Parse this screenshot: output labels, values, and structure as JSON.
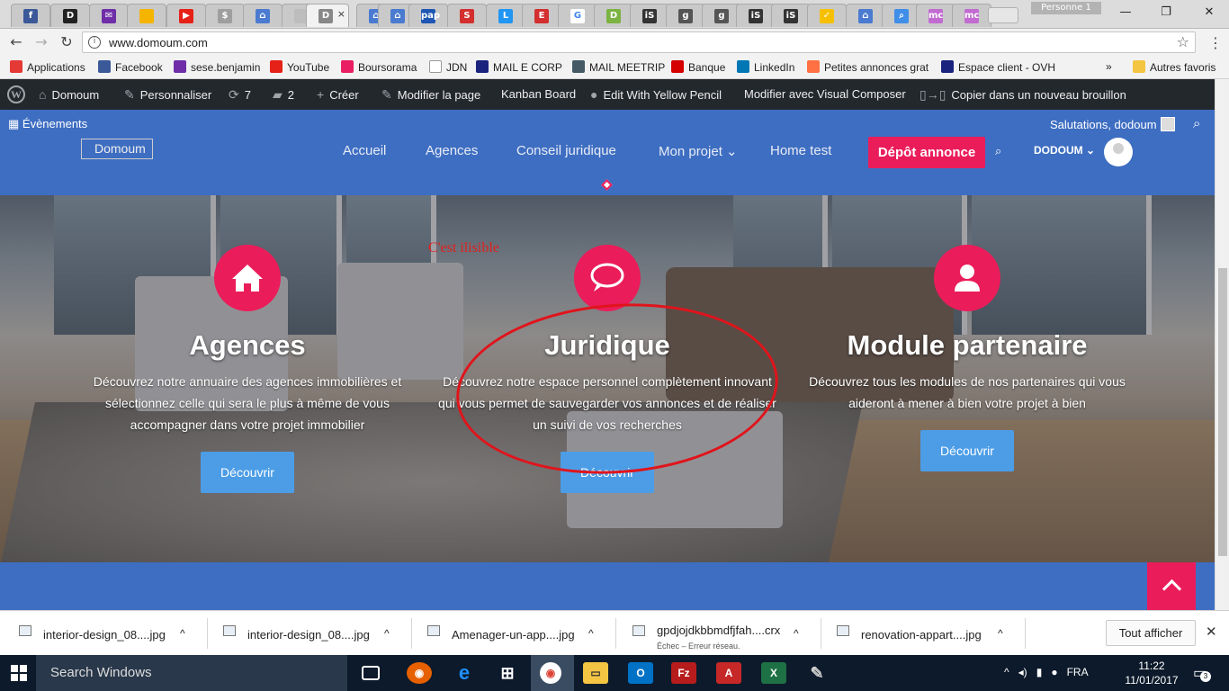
{
  "browser": {
    "tabs": [
      {
        "icon": "facebook-favicon",
        "color": "#3b5998",
        "glyph": "f"
      },
      {
        "icon": "dark-d-favicon",
        "color": "#222",
        "glyph": "D"
      },
      {
        "icon": "mail-favicon",
        "color": "#6f2da8",
        "glyph": "✉"
      },
      {
        "icon": "yellow-favicon",
        "color": "#f4b400",
        "glyph": ""
      },
      {
        "icon": "youtube-favicon",
        "color": "#e62117",
        "glyph": "▶"
      },
      {
        "icon": "page-favicon",
        "color": "#9e9e9e",
        "glyph": "$"
      },
      {
        "icon": "house-favicon",
        "color": "#4a7bd0",
        "glyph": "⌂"
      },
      {
        "icon": "blank-page-favicon",
        "color": "#bdbdbd",
        "glyph": ""
      },
      {
        "icon": "active-tab-favicon",
        "color": "#888",
        "glyph": "D"
      },
      {
        "icon": "house-favicon-2",
        "color": "#4a7bd0",
        "glyph": "⌂"
      },
      {
        "icon": "house-favicon-3",
        "color": "#4a7bd0",
        "glyph": "⌂"
      },
      {
        "icon": "pap-favicon",
        "color": "#1e56b3",
        "glyph": "pap"
      },
      {
        "icon": "s-favicon",
        "color": "#d32f2f",
        "glyph": "S"
      },
      {
        "icon": "l-favicon",
        "color": "#2196f3",
        "glyph": "L"
      },
      {
        "icon": "e-favicon",
        "color": "#d32f2f",
        "glyph": "E"
      },
      {
        "icon": "google-favicon",
        "color": "#ffffff",
        "glyph": "G"
      },
      {
        "icon": "d-green-favicon",
        "color": "#7cb342",
        "glyph": "D"
      },
      {
        "icon": "is-favicon",
        "color": "#333",
        "glyph": "iS"
      },
      {
        "icon": "g-favicon",
        "color": "#555",
        "glyph": "g"
      },
      {
        "icon": "g-favicon-2",
        "color": "#555",
        "glyph": "g"
      },
      {
        "icon": "is-favicon-2",
        "color": "#333",
        "glyph": "iS"
      },
      {
        "icon": "is-favicon-3",
        "color": "#333",
        "glyph": "iS"
      },
      {
        "icon": "norton-favicon",
        "color": "#f6c000",
        "glyph": "✓"
      },
      {
        "icon": "house-favicon-4",
        "color": "#4a7bd0",
        "glyph": "⌂"
      },
      {
        "icon": "search-favicon",
        "color": "#3f8ee8",
        "glyph": "⌕"
      },
      {
        "icon": "mc-favicon",
        "color": "#c26bd1",
        "glyph": "mc"
      },
      {
        "icon": "mc-favicon-2",
        "color": "#c26bd1",
        "glyph": "mc"
      }
    ],
    "active_tab_glyph": "D",
    "tab_close": "×",
    "profile_label": "Personne 1",
    "url": "www.domoum.com",
    "bookmarks": [
      {
        "label": "Applications",
        "color": "#e53935"
      },
      {
        "label": "Facebook",
        "color": "#3b5998"
      },
      {
        "label": "sese.benjamin",
        "color": "#6f2da8"
      },
      {
        "label": "YouTube",
        "color": "#e62117"
      },
      {
        "label": "Boursorama",
        "color": "#e91e63"
      },
      {
        "label": "JDN",
        "color": "#ffffff"
      },
      {
        "label": "MAIL E CORP",
        "color": "#1a237e"
      },
      {
        "label": "MAIL MEETRIP",
        "color": "#455a64"
      },
      {
        "label": "Banque",
        "color": "#d50000"
      },
      {
        "label": "LinkedIn",
        "color": "#0077b5"
      },
      {
        "label": "Petites annonces grat",
        "color": "#ff7043"
      },
      {
        "label": "Espace client - OVH",
        "color": "#1a237e"
      }
    ],
    "bookmarks_more": "»",
    "other_bookmarks": "Autres favoris"
  },
  "wpbar": {
    "site_name": "Domoum",
    "customize": "Personnaliser",
    "updates_count": "7",
    "comments_count": "2",
    "new": "Créer",
    "edit_page": "Modifier la page",
    "kanban": "Kanban Board",
    "yellow_pencil": "Edit With Yellow Pencil",
    "visual_composer": "Modifier avec Visual Composer",
    "copy_draft": "Copier dans un nouveau brouillon"
  },
  "site": {
    "events_label": "Évènements",
    "greeting": "Salutations, dodoum",
    "logo_alt": "Domoum",
    "nav": [
      "Accueil",
      "Agences",
      "Conseil juridique",
      "Mon projet",
      "Home test"
    ],
    "mon_projet_caret": "⌄",
    "deposit_button": "Dépôt annonce",
    "user_name": "DODOUM",
    "features": [
      {
        "title": "Agences",
        "desc": "Découvrez notre annuaire des agences immobilières et sélectionnez celle qui sera le plus à même de vous accompagner dans votre projet immobilier",
        "button": "Découvrir"
      },
      {
        "title": "Juridique",
        "desc": "Découvrez notre espace personnel complètement innovant qui vous permet de sauvegarder vos annonces et de réaliser un suivi de vos recherches",
        "button": "Découvrir"
      },
      {
        "title": "Module partenaire",
        "desc": "Découvrez tous les modules de nos partenaires qui vous aideront à mener à bien votre projet à bien",
        "button": "Découvrir"
      }
    ],
    "annotation": "C'est ilisible"
  },
  "downloads": {
    "items": [
      {
        "name": "interior-design_08....jpg",
        "sub": ""
      },
      {
        "name": "interior-design_08....jpg",
        "sub": ""
      },
      {
        "name": "Amenager-un-app....jpg",
        "sub": ""
      },
      {
        "name": "gpdjojdkbbmdfjfah....crx",
        "sub": "Échec – Erreur réseau."
      },
      {
        "name": "renovation-appart....jpg",
        "sub": ""
      }
    ],
    "show_all": "Tout afficher",
    "close": "✕"
  },
  "taskbar": {
    "search_placeholder": "Search Windows",
    "language": "FRA",
    "time": "11:22",
    "date": "11/01/2017",
    "notifications": "3"
  }
}
